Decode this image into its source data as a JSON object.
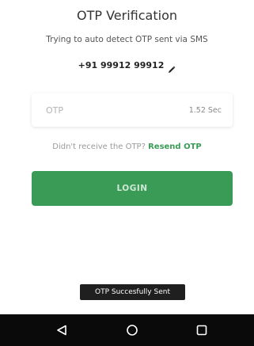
{
  "header": {
    "title": "OTP Verification",
    "subtitle": "Trying to auto detect OTP sent via SMS",
    "phone_number": "+91 99912 99912"
  },
  "otp": {
    "placeholder": "OTP",
    "value": "",
    "timer": "1.52 Sec"
  },
  "resend": {
    "prompt": "Didn't receive the OTP?",
    "link_label": "Resend OTP"
  },
  "login": {
    "label": "LOGIN"
  },
  "toast": {
    "message": "OTP Succesfully Sent"
  },
  "icons": {
    "edit": "pencil-icon",
    "back": "back-triangle-icon",
    "home": "home-circle-icon",
    "recent": "recent-apps-square-icon"
  },
  "colors": {
    "accent": "#3a9b57",
    "nav_bar": "#0a0a0a",
    "toast_bg": "#1f1f1f"
  }
}
